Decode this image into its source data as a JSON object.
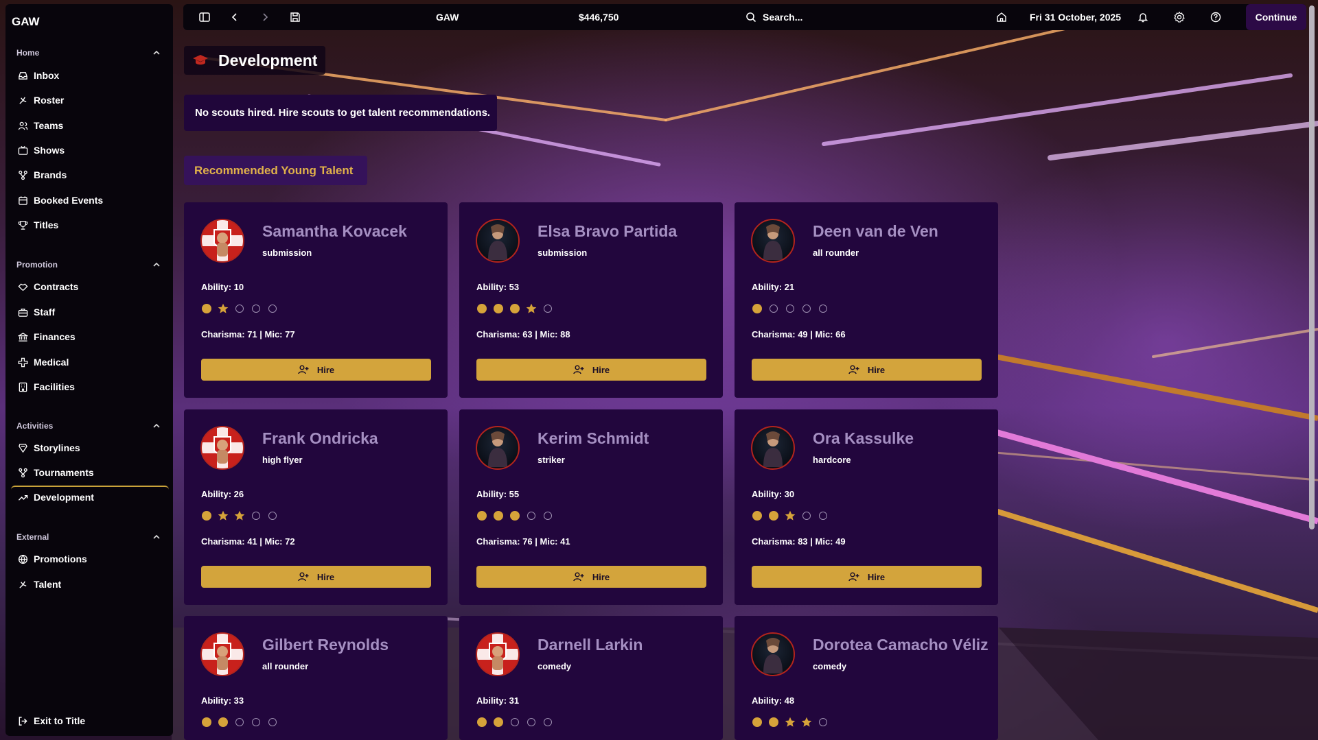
{
  "app": {
    "brand": "GAW"
  },
  "topbar": {
    "promotion": "GAW",
    "money": "$446,750",
    "search_placeholder": "Search...",
    "date": "Fri 31 October, 2025",
    "continue_label": "Continue"
  },
  "sidebar": {
    "sections": [
      {
        "title": "Home",
        "items": [
          "Inbox",
          "Roster",
          "Teams",
          "Shows",
          "Brands",
          "Booked Events",
          "Titles"
        ]
      },
      {
        "title": "Promotion",
        "items": [
          "Contracts",
          "Staff",
          "Finances",
          "Medical",
          "Facilities"
        ]
      },
      {
        "title": "Activities",
        "items": [
          "Storylines",
          "Tournaments",
          "Development"
        ]
      },
      {
        "title": "External",
        "items": [
          "Promotions",
          "Talent"
        ]
      }
    ],
    "exit_label": "Exit to Title",
    "active_item": "Development"
  },
  "main": {
    "title": "Development",
    "notice": "No scouts hired. Hire scouts to get talent recommendations.",
    "section_heading": "Recommended Young Talent",
    "hire_label": "Hire",
    "talents": [
      {
        "name": "Samantha Kovacek",
        "style": "submission",
        "ability": "Ability: 10",
        "stars": [
          1,
          "s",
          0,
          0,
          0
        ],
        "stats": "Charisma: 71 | Mic: 77",
        "avatar": "red"
      },
      {
        "name": "Elsa Bravo Partida",
        "style": "submission",
        "ability": "Ability: 53",
        "stars": [
          1,
          1,
          1,
          "s",
          0
        ],
        "stats": "Charisma: 63 | Mic: 88",
        "avatar": "dark"
      },
      {
        "name": "Deen van de Ven",
        "style": "all rounder",
        "ability": "Ability: 21",
        "stars": [
          1,
          0,
          0,
          0,
          0
        ],
        "stats": "Charisma: 49 | Mic: 66",
        "avatar": "dark"
      },
      {
        "name": "Frank Ondricka",
        "style": "high flyer",
        "ability": "Ability: 26",
        "stars": [
          1,
          "s",
          "s",
          0,
          0
        ],
        "stats": "Charisma: 41 | Mic: 72",
        "avatar": "red"
      },
      {
        "name": "Kerim Schmidt",
        "style": "striker",
        "ability": "Ability: 55",
        "stars": [
          1,
          1,
          1,
          0,
          0
        ],
        "stats": "Charisma: 76 | Mic: 41",
        "avatar": "dark"
      },
      {
        "name": "Ora Kassulke",
        "style": "hardcore",
        "ability": "Ability: 30",
        "stars": [
          1,
          1,
          "s",
          0,
          0
        ],
        "stats": "Charisma: 83 | Mic: 49",
        "avatar": "dark"
      },
      {
        "name": "Gilbert Reynolds",
        "style": "all rounder",
        "ability": "Ability: 33",
        "stars": [
          1,
          1,
          0,
          0,
          0
        ],
        "stats": "",
        "avatar": "red"
      },
      {
        "name": "Darnell Larkin",
        "style": "comedy",
        "ability": "Ability: 31",
        "stars": [
          1,
          1,
          0,
          0,
          0
        ],
        "stats": "",
        "avatar": "red"
      },
      {
        "name": "Dorotea Camacho Véliz",
        "style": "comedy",
        "ability": "Ability: 48",
        "stars": [
          1,
          1,
          "s",
          "s",
          0
        ],
        "stats": "",
        "avatar": "dark"
      }
    ]
  },
  "colors": {
    "accent": "#d3a43c",
    "card": "#22063d",
    "name": "#a58fc2",
    "heading": "#e1b24a"
  },
  "icons": [
    "sidebar-toggle-icon",
    "back-icon",
    "forward-icon",
    "save-icon",
    "search-icon",
    "home-icon",
    "bell-icon",
    "gear-icon",
    "help-icon",
    "user-plus-icon",
    "mortarboard-icon"
  ]
}
